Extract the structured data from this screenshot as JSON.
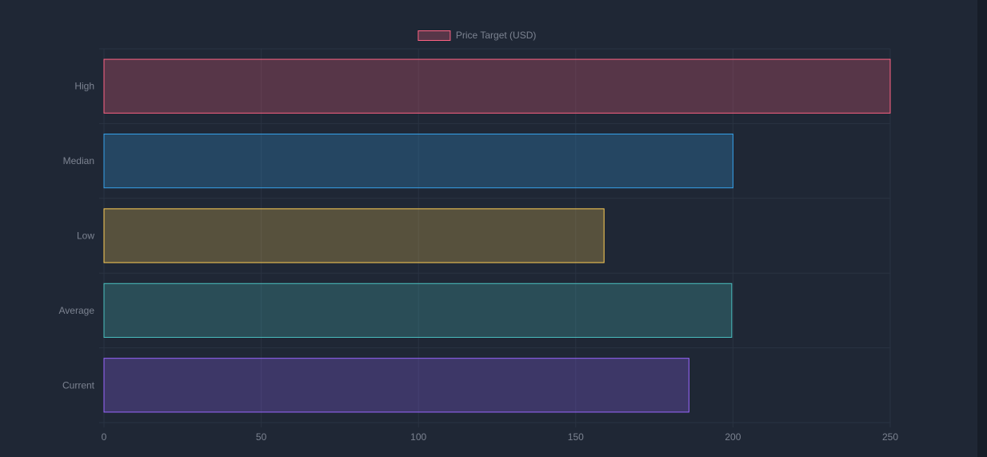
{
  "chart_data": {
    "type": "bar",
    "orientation": "horizontal",
    "categories": [
      "High",
      "Median",
      "Low",
      "Average",
      "Current"
    ],
    "series": [
      {
        "name": "Price Target (USD)",
        "values": [
          250,
          200,
          159,
          199.6,
          186
        ]
      }
    ],
    "xlim": [
      0,
      250
    ],
    "xticks": [
      0,
      50,
      100,
      150,
      200,
      250
    ],
    "grid": true,
    "legend_position": "top",
    "colors": {
      "High": "#ff6384",
      "Median": "#36a2eb",
      "Low": "#ffce56",
      "Average": "#4bc0c0",
      "Current": "#9966ff"
    },
    "legend_color": "#ff6384",
    "grid_color": "#2a3342",
    "text_color": "#7c8391"
  }
}
